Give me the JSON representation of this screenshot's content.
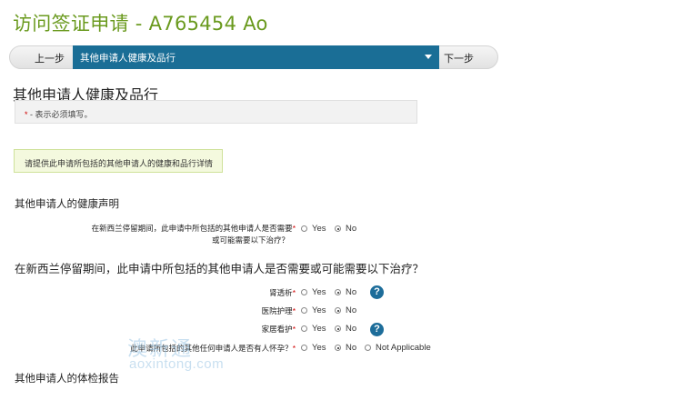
{
  "app": {
    "title": "访问签证申请 - A765454 Ao"
  },
  "nav": {
    "prev": "上一步",
    "current": "其他申请人健康及品行",
    "next": "下一步"
  },
  "section_title": "其他申请人健康及品行",
  "required_note": {
    "star": "*",
    "text": " - 表示必须填写。"
  },
  "info_text": "请提供此申请所包括的其他申请人的健康和品行详情",
  "health_heading": "其他申请人的健康声明",
  "q1": {
    "line1": "在新西兰停留期间，此申请中所包括的其他申请人是否需要",
    "line2": "或可能需要以下治疗？",
    "star": "*",
    "yes": "Yes",
    "no": "No",
    "selected": "No"
  },
  "big_question": "在新西兰停留期间，此申请中所包括的其他申请人是否需要或可能需要以下治疗？",
  "treatments": [
    {
      "label": "肾透析",
      "star": "*",
      "yes": "Yes",
      "no": "No",
      "selected": "No",
      "help": "?"
    },
    {
      "label": "医院护理",
      "star": "*",
      "yes": "Yes",
      "no": "No",
      "selected": "No"
    },
    {
      "label": "家居看护",
      "star": "*",
      "yes": "Yes",
      "no": "No",
      "selected": "No",
      "help": "?"
    }
  ],
  "pregnancy": {
    "label": "此申请所包括的其他任何申请人是否有人怀孕？",
    "star": "*",
    "yes": "Yes",
    "no": "No",
    "na": "Not Applicable",
    "selected": "No"
  },
  "medical_heading": "其他申请人的体检报告",
  "watermark": {
    "cn": "澳新通",
    "en": "aoxintong.com"
  }
}
